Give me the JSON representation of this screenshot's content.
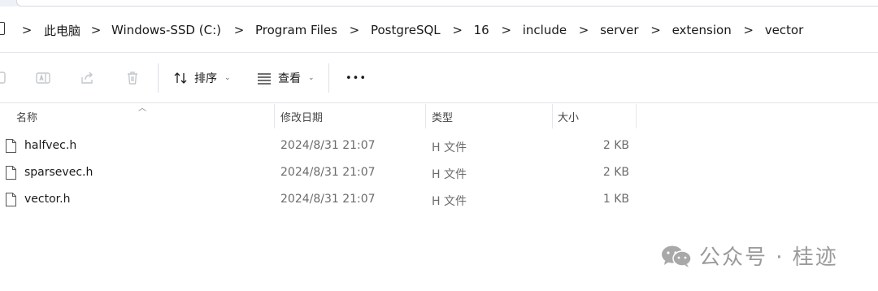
{
  "breadcrumb": {
    "items": [
      "此电脑",
      "Windows-SSD (C:)",
      "Program Files",
      "PostgreSQL",
      "16",
      "include",
      "server",
      "extension",
      "vector"
    ],
    "separator": ">"
  },
  "toolbar": {
    "icons": [
      "copy-icon",
      "rename-icon",
      "share-icon",
      "delete-icon"
    ],
    "sort_label": "排序",
    "view_label": "查看",
    "more_label": "•••"
  },
  "columns": {
    "name": "名称",
    "date": "修改日期",
    "type": "类型",
    "size": "大小"
  },
  "files": [
    {
      "name": "halfvec.h",
      "date": "2024/8/31 21:07",
      "type": "H 文件",
      "size": "2 KB"
    },
    {
      "name": "sparsevec.h",
      "date": "2024/8/31 21:07",
      "type": "H 文件",
      "size": "2 KB"
    },
    {
      "name": "vector.h",
      "date": "2024/8/31 21:07",
      "type": "H 文件",
      "size": "1 KB"
    }
  ],
  "watermark": {
    "text": "公众号 · 桂迹",
    "logo": "wechat-logo"
  }
}
